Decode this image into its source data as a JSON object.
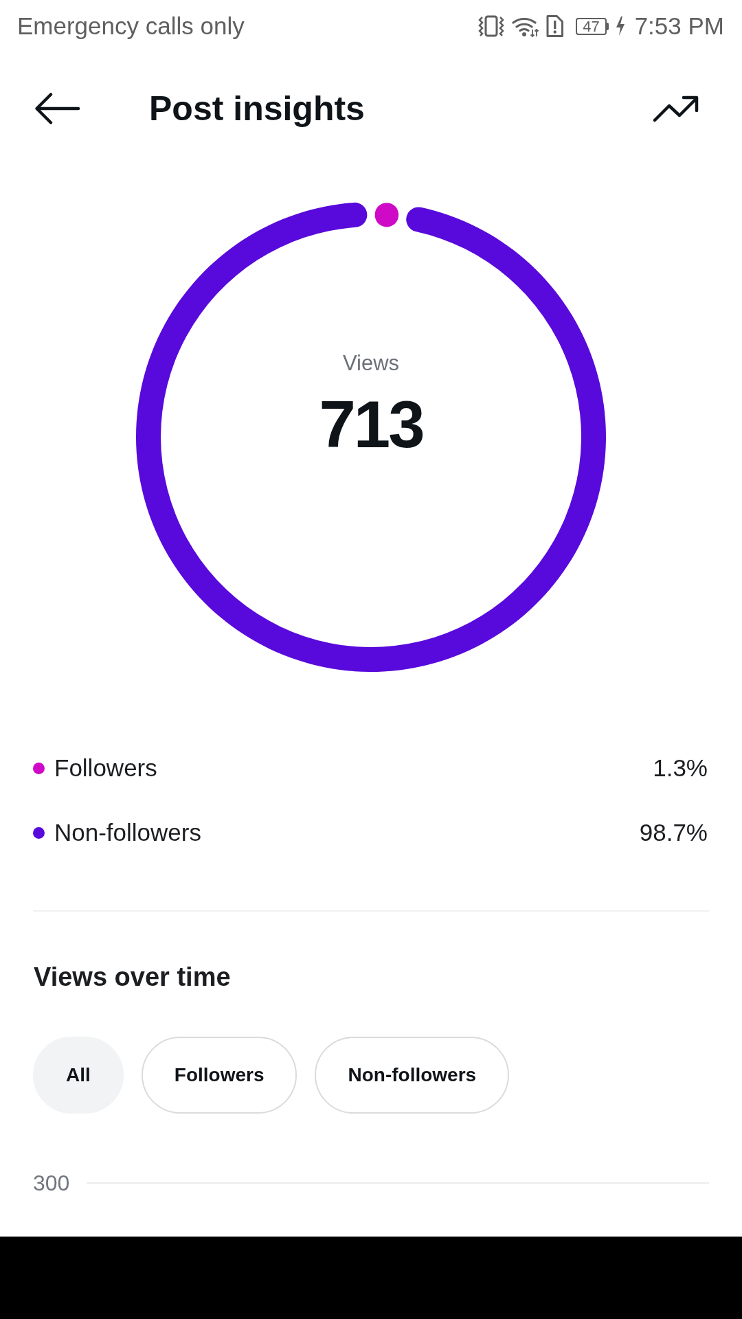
{
  "status_bar": {
    "carrier": "Emergency calls only",
    "battery": "47",
    "charging": true,
    "time": "7:53 PM"
  },
  "header": {
    "title": "Post insights"
  },
  "views_summary": {
    "label": "Views",
    "total": "713",
    "chart_data": {
      "type": "donut",
      "values": [
        1.3,
        98.7
      ]
    }
  },
  "legend": [
    {
      "label": "Followers",
      "value": "1.3%",
      "color": "#cf0ac6"
    },
    {
      "label": "Non-followers",
      "value": "98.7%",
      "color": "#5809db"
    }
  ],
  "views_over_time": {
    "title": "Views over time",
    "filters": [
      {
        "label": "All",
        "selected": true
      },
      {
        "label": "Followers",
        "selected": false
      },
      {
        "label": "Non-followers",
        "selected": false
      }
    ],
    "axis_labels": [
      "300"
    ]
  }
}
